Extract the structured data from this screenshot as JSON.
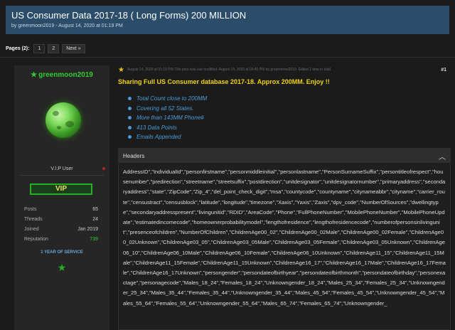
{
  "thread": {
    "title": "US Consumer Data 2017-18 ( Long Forms) 200 MILLION",
    "byline": "by greenmoon2019 - August 14, 2020 at 01:19 PM"
  },
  "pagination": {
    "label": "Pages (2):",
    "pages": [
      "1",
      "2"
    ],
    "next": "Next »"
  },
  "user": {
    "star": "★",
    "name": "greenmoon2019",
    "title": "V.I.P User",
    "badge": "VIP",
    "stats": [
      {
        "label": "Posts",
        "value": "65"
      },
      {
        "label": "Threads",
        "value": "24"
      },
      {
        "label": "Joined",
        "value": "Jan 2019"
      },
      {
        "label": "Reputation",
        "value": "739"
      }
    ],
    "service": "1 YEAR OF SERVICE",
    "bottom_star": "★"
  },
  "post": {
    "meta": "August 14, 2020 at 01:19 PM   This post was last modified: August 14, 2020 at 09:45 PM by greenmoon2019. Edited 1 time in total.",
    "number": "#1",
    "heading": "Sharing Full US Consumer database 2017-18. Approx 200MM. Enjoy !!",
    "features": [
      "Total Count close to 200MM",
      "Covering all 52 States.",
      "More than 143MM Phone#",
      "413 Data Points",
      "Emails Appended"
    ],
    "spoiler": {
      "title": "Headers",
      "toggle_icon": "chevron-up-icon",
      "body": "AddressID\",\"IndividualId\",\"personfirstname\",\"personmiddleinitial\",\"personlastname\",\"PersonSurnameSuffix\",\"persontitleofrespect\",\"housenumber\",\"predirection\",\"streetname\",\"streetsuffix\",\"postdirection\",\"unitdesignator\",\"unitdesignatornumber\",\"primaryaddress\",\"secondaryaddress\",\"state\",\"ZipCode\",\"Zip_4\",\"del_point_check_digit\",\"msa\",\"countycode\",\"countyname\",\"citynameabbr\",\"cityname\",\"carrier_route\",\"censustract\",\"censusblock\",\"latitude\",\"longitude\",\"timezone\",\"Xaxis\",\"Yaxis\",\"Zaxis\",\"dpv_code\",\"NumberOfSources\",\"dwellingtype\",\"secondaryaddresspresent\",\"livingunitid\",\"RDID\",\"AreaCode\",\"Phone\",\"FullPhoneNumber\",\"MobilePhoneNumber\",\"MobilePhoneUpdate\",\"estimatedincomecode\",\"homeownerprobabilitymodel\",\"lengthofresidence\",\"lengthofresidencecode\",\"numberofpersonsinlivingunit\",\"presenceofchildren\",\"NumberOfChildren\",\"ChildrenAge00_02\",\"ChildrenAge00_02Male\",\"ChildrenAge00_02Female\",\"ChildrenAge00_02Unknown\",\"ChildrenAge03_05\",\"ChildrenAge03_05Male\",\"ChildrenAge03_05Female\",\"ChildrenAge03_05Unknown\",\"ChildrenAge06_10\",\"ChildrenAge06_10Male\",\"ChildrenAge06_10Female\",\"ChildrenAge06_10Unknown\",\"ChildrenAge11_15\",\"ChildrenAge11_15Male\",\"ChildrenAge11_15Female\",\"ChildrenAge11_15Unknown\",\"ChildrenAge16_17\",\"ChildrenAge16_17Male\",\"ChildrenAge16_17Female\",\"ChildrenAge16_17Unknown\",\"persongender\",\"persondateofbirthyear\",\"persondateofbirthmonth\",\"persondateofbirthday\",\"personexactage\",\"personagecode\",\"Males_18_24\",\"Females_18_24\",\"Unknowngender_18_24\",\"Males_25_34\",\"Females_25_34\",\"Unknowngender_25_34\",\"Males_35_44\",\"Females_35_44\",\"Unknowngender_35_44\",\"Males_45_54\",\"Females_45_54\",\"Unknowngender_45_54\",\"Males_55_64\",\"Females_55_64\",\"Unknowngender_55_64\",\"Males_65_74\",\"Females_65_74\",\"Unknowngender_"
    }
  },
  "colors": {
    "header_bg": "#2b4d6a",
    "username": "#33cc33",
    "heading": "#f0d312",
    "link": "#4b9bd8",
    "vip_border": "#25b025"
  }
}
